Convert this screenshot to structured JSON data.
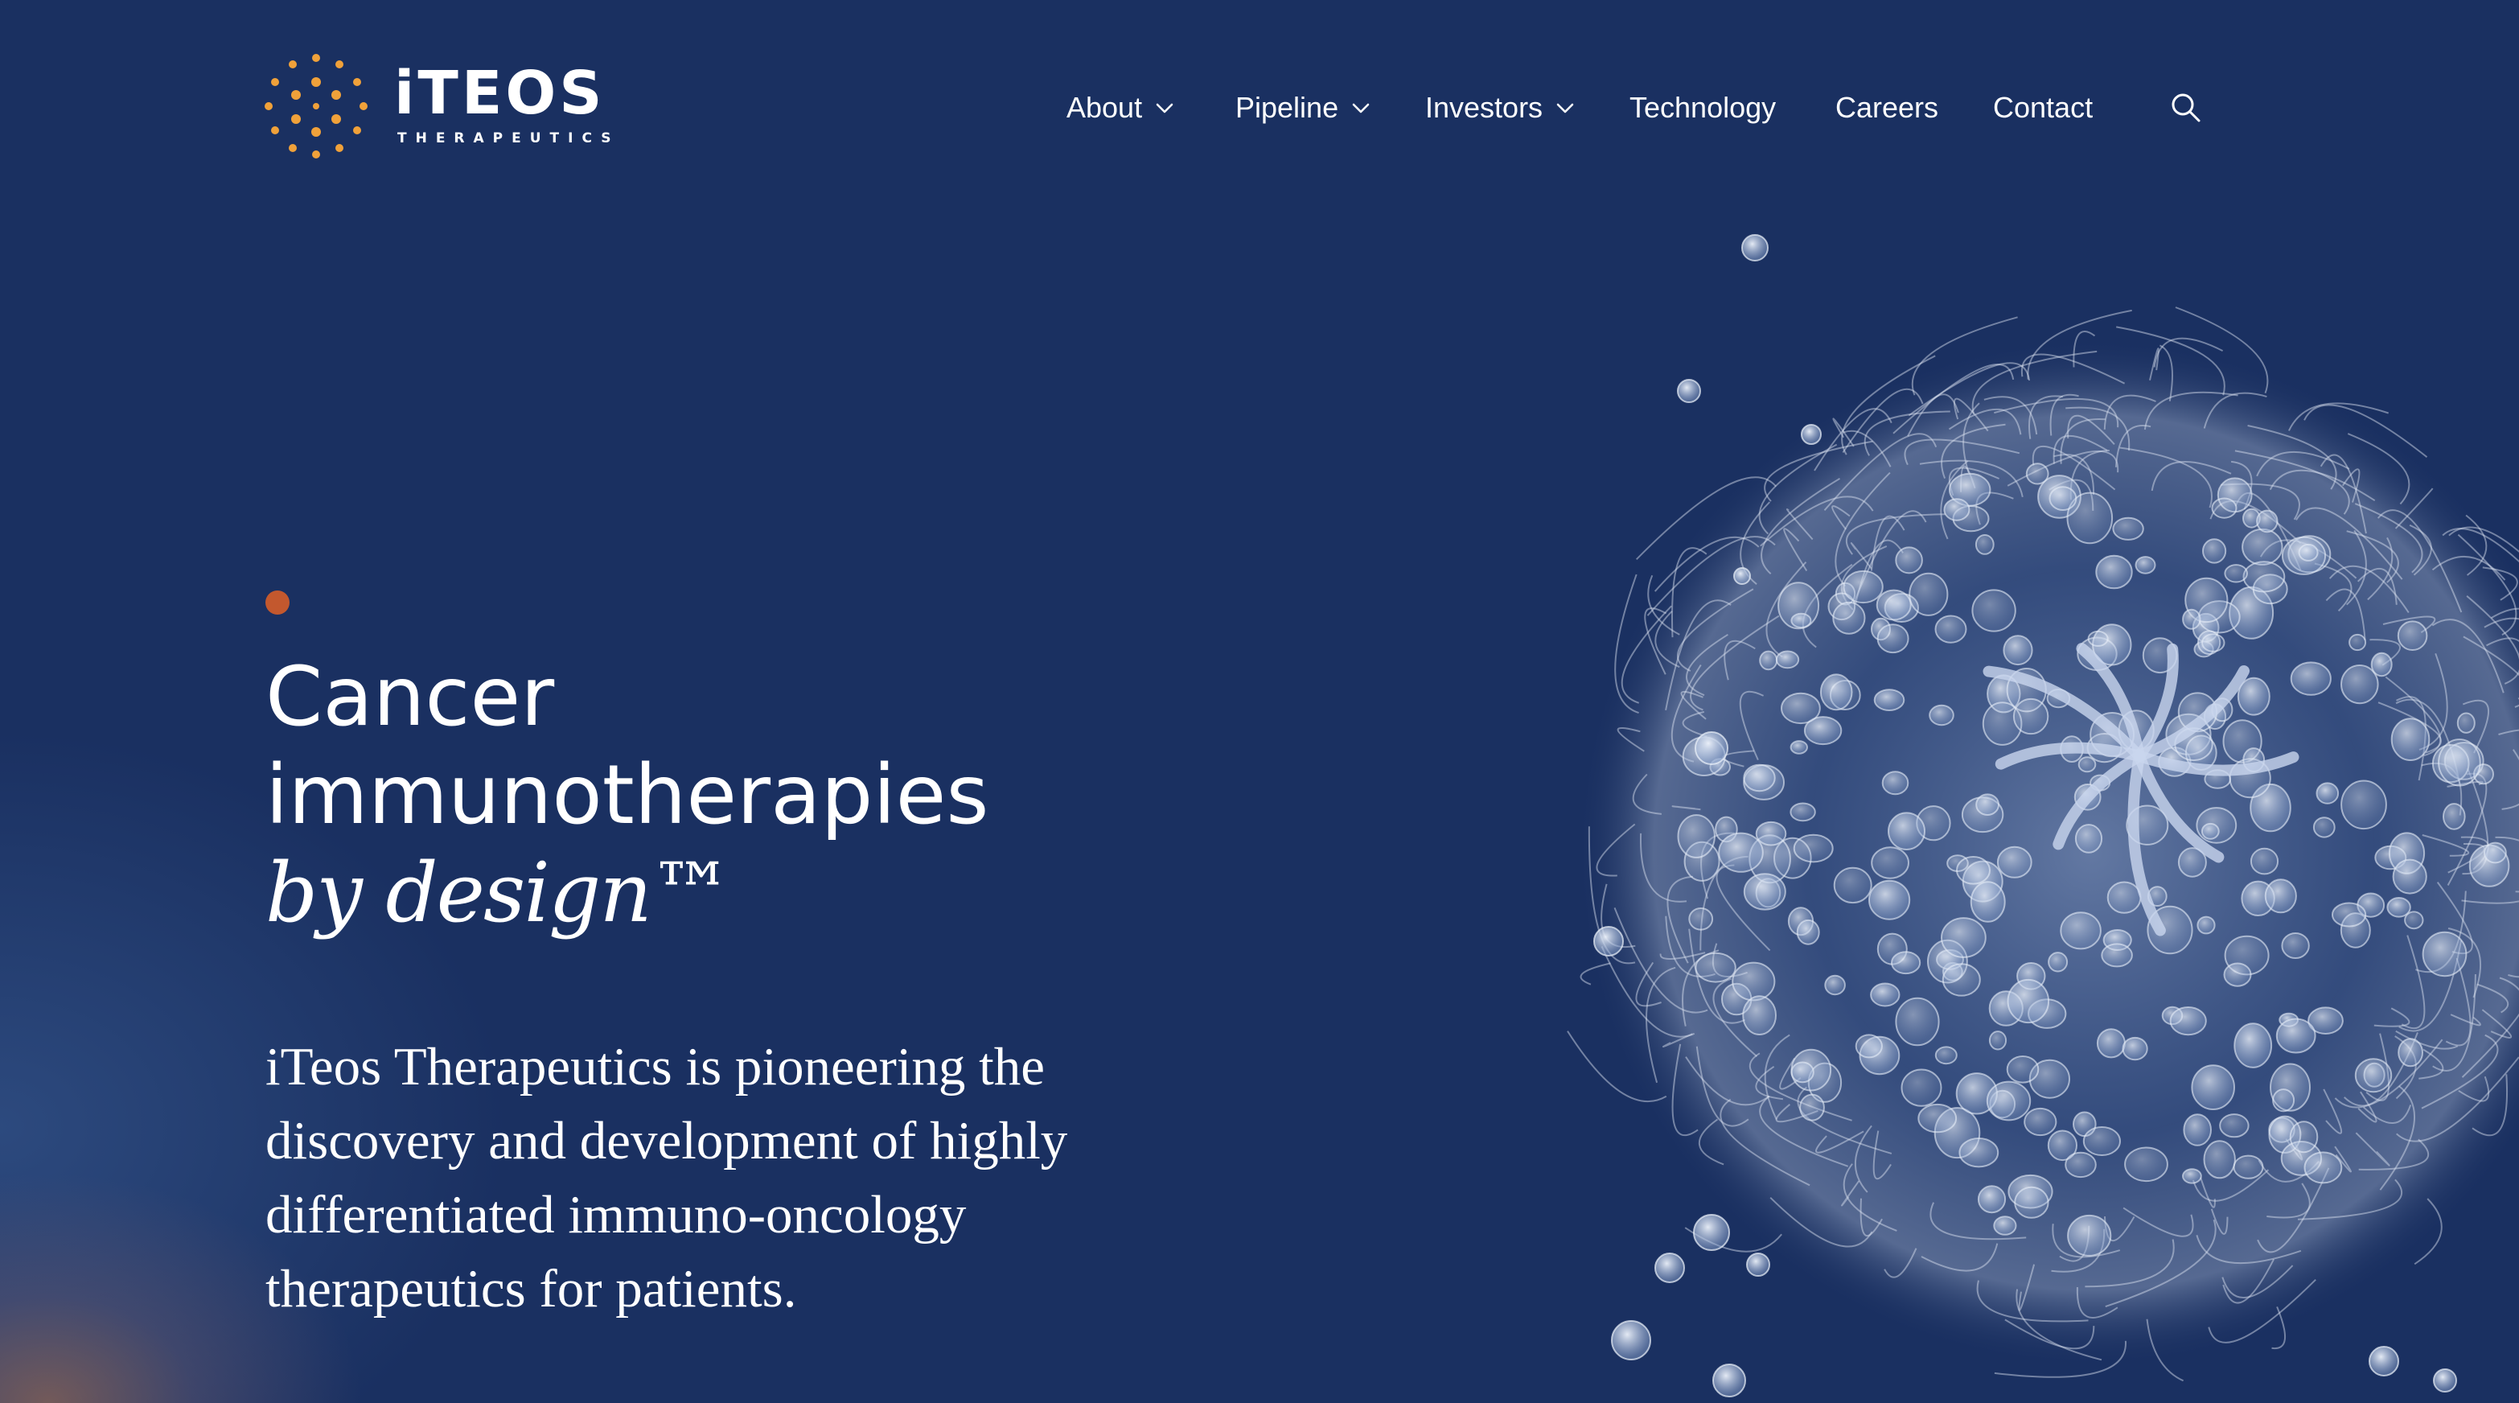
{
  "brand": {
    "name": "iTEOS",
    "tagline": "THERAPEUTICS",
    "logo_dot_color": "#f0a13a"
  },
  "nav": {
    "items": [
      {
        "label": "About",
        "has_dropdown": true
      },
      {
        "label": "Pipeline",
        "has_dropdown": true
      },
      {
        "label": "Investors",
        "has_dropdown": true
      },
      {
        "label": "Technology",
        "has_dropdown": false
      },
      {
        "label": "Careers",
        "has_dropdown": false
      },
      {
        "label": "Contact",
        "has_dropdown": false
      }
    ],
    "dropdown_icon": "chevron-down-icon",
    "search_icon": "search-icon"
  },
  "hero": {
    "headline_line1": "Cancer",
    "headline_line2": "immunotherapies",
    "headline_line3": "by design™",
    "lede": "iTeos Therapeutics is pioneering the discovery and development of highly differentiated immuno-oncology therapeutics for patients.",
    "accent_dot_color": "#c3582e",
    "illustration": "cancer-cell-illustration"
  },
  "colors": {
    "background": "#1a3061",
    "text": "#ffffff",
    "accent": "#c3582e"
  }
}
